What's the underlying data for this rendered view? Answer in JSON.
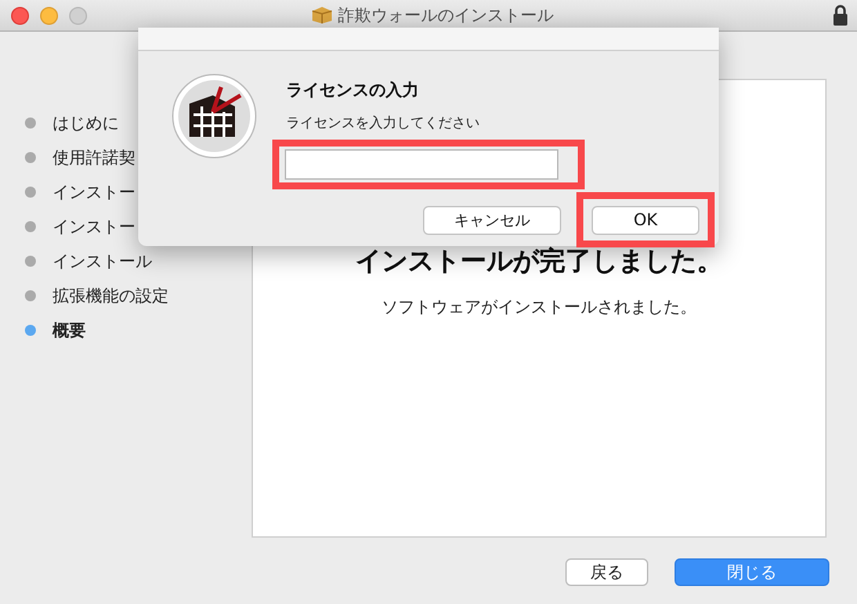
{
  "window": {
    "title": "詐欺ウォールのインストール"
  },
  "sidebar": {
    "items": [
      {
        "label": "はじめに",
        "selected": false
      },
      {
        "label": "使用許諾契",
        "selected": false
      },
      {
        "label": "インストー",
        "selected": false
      },
      {
        "label": "インストー",
        "selected": false
      },
      {
        "label": "インストール",
        "selected": false
      },
      {
        "label": "拡張機能の設定",
        "selected": false
      },
      {
        "label": "概要",
        "selected": true
      }
    ]
  },
  "content": {
    "heading": "インストールが完了しました。",
    "message": "ソフトウェアがインストールされました。"
  },
  "buttons": [
    {
      "label": "戻る",
      "kind": "secondary"
    },
    {
      "label": "閉じる",
      "kind": "primary"
    }
  ],
  "dialog": {
    "title": "ライセンスの入力",
    "prompt": "ライセンスを入力してください",
    "input": {
      "highlighted": true
    },
    "buttons": [
      {
        "label": "キャンセル",
        "highlighted": false
      },
      {
        "label": "OK",
        "highlighted": true
      }
    ]
  }
}
